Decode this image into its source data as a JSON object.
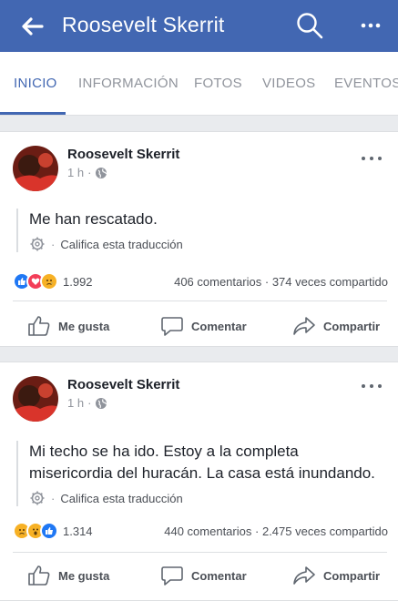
{
  "header": {
    "title": "Roosevelt Skerrit",
    "icons": [
      "back-arrow-icon",
      "search-icon",
      "more-icon"
    ],
    "bar_color": "#4267b2"
  },
  "tabs": [
    {
      "label": "INICIO",
      "active": true
    },
    {
      "label": "INFORMACIÓN",
      "active": false
    },
    {
      "label": "FOTOS",
      "active": false
    },
    {
      "label": "VIDEOS",
      "active": false
    },
    {
      "label": "EVENTOS",
      "active": false
    }
  ],
  "posts": [
    {
      "author": "Roosevelt Skerrit",
      "time": "1 h",
      "separator": "·",
      "text": "Me han rescatado.",
      "rate_translation": "Califica esta traducción",
      "rate_dot": "·",
      "reaction_icons": [
        "like-icon",
        "love-icon",
        "sad-icon"
      ],
      "reaction_count": "1.992",
      "comments": "406 comentarios",
      "shares": "374 veces compartido",
      "stats_dot": "·",
      "actions": {
        "like": "Me gusta",
        "comment": "Comentar",
        "share": "Compartir"
      }
    },
    {
      "author": "Roosevelt Skerrit",
      "time": "1 h",
      "separator": "·",
      "text": "Mi techo se ha ido. Estoy a la completa misericordia del huracán. La casa está inundando.",
      "rate_translation": "Califica esta traducción",
      "rate_dot": "·",
      "reaction_icons": [
        "sad-icon",
        "wow-icon",
        "like-icon"
      ],
      "reaction_count": "1.314",
      "comments": "440 comentarios",
      "shares": "2.475 veces compartido",
      "stats_dot": "·",
      "actions": {
        "like": "Me gusta",
        "comment": "Comentar",
        "share": "Compartir"
      }
    }
  ]
}
